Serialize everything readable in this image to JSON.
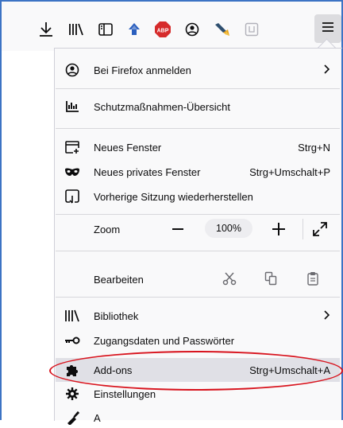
{
  "toolbar": {
    "icons": [
      "download-icon",
      "library-icon",
      "sidebar-icon",
      "extension-icon",
      "abp-icon",
      "account-icon",
      "pencil-extension-icon",
      "container-icon",
      "hamburger-menu-icon"
    ],
    "abp_badge": "ABP"
  },
  "menu": {
    "account": {
      "label": "Bei Firefox anmelden"
    },
    "protections": {
      "label": "Schutzmaßnahmen-Übersicht"
    },
    "new_window": {
      "label": "Neues Fenster",
      "shortcut": "Strg+N"
    },
    "new_private": {
      "label": "Neues privates Fenster",
      "shortcut": "Strg+Umschalt+P"
    },
    "restore": {
      "label": "Vorherige Sitzung wiederherstellen"
    },
    "zoom": {
      "label": "Zoom",
      "value": "100%"
    },
    "edit": {
      "label": "Bearbeiten"
    },
    "library": {
      "label": "Bibliothek"
    },
    "logins": {
      "label": "Zugangsdaten und Passwörter"
    },
    "addons": {
      "label": "Add-ons",
      "shortcut": "Strg+Umschalt+A"
    },
    "settings": {
      "label": "Einstellungen"
    },
    "more": {
      "label": "A"
    }
  },
  "colors": {
    "highlight": "#d8141e",
    "frame": "#3c73c4",
    "hover": "#e0e0e6",
    "abp_red": "#d62b2b",
    "extension_blue": "#2b5fbe"
  }
}
